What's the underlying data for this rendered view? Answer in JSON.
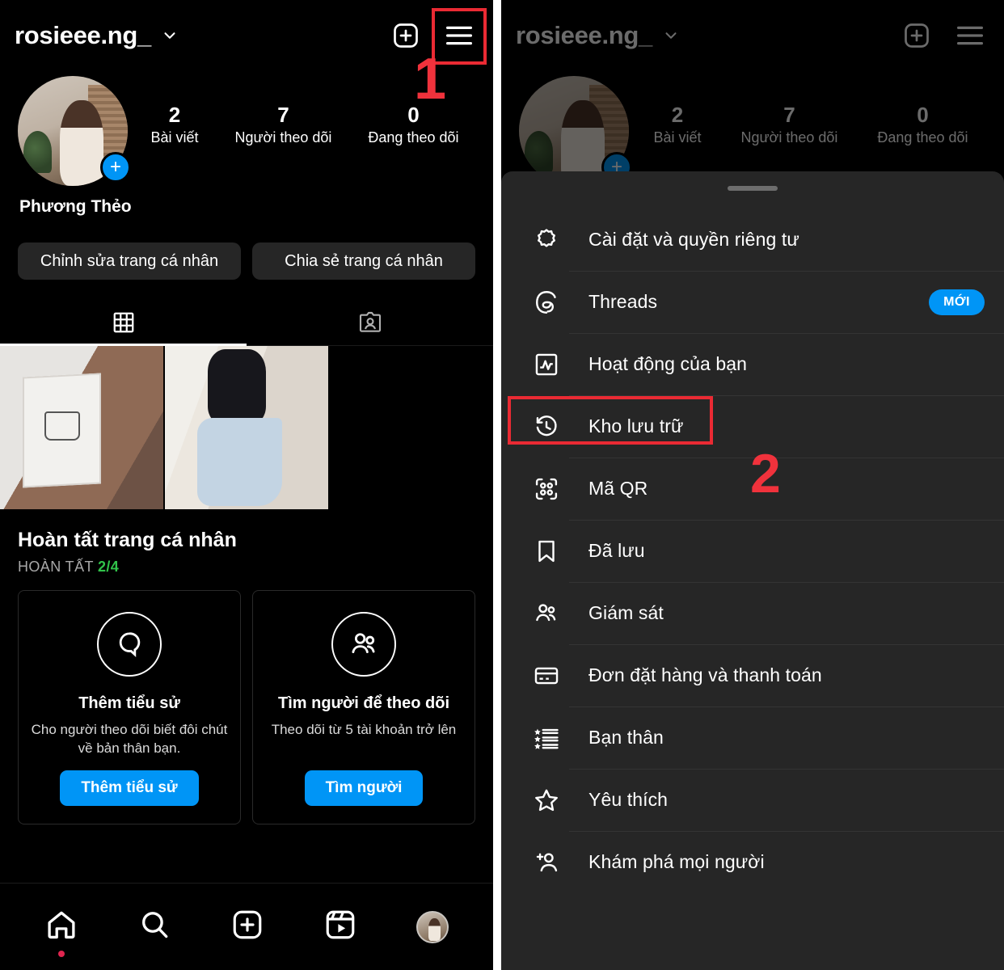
{
  "profile": {
    "username": "rosieee.ng_",
    "display_name": "Phương Thẻo",
    "stats": [
      {
        "value": "2",
        "label": "Bài viết"
      },
      {
        "value": "7",
        "label": "Người theo dõi"
      },
      {
        "value": "0",
        "label": "Đang theo dõi"
      }
    ],
    "buttons": {
      "edit_profile": "Chỉnh sửa trang cá nhân",
      "share_profile": "Chia sẻ trang cá nhân"
    },
    "tabs": [
      {
        "name": "grid-tab",
        "icon": "grid-icon",
        "active": true
      },
      {
        "name": "tagged-tab",
        "icon": "tagged-person-icon",
        "active": false
      }
    ]
  },
  "complete_profile": {
    "title": "Hoàn tất trang cá nhân",
    "progress_label": "HOÀN TẤT",
    "progress_value": "2/4",
    "progress_color": "#31c34b",
    "cards": [
      {
        "icon": "bio-bubble-icon",
        "title": "Thêm tiểu sử",
        "desc": "Cho người theo dõi biết đôi chút về bản thân bạn.",
        "cta": "Thêm tiểu sử"
      },
      {
        "icon": "people-icon",
        "title": "Tìm người để theo dõi",
        "desc": "Theo dõi từ 5 tài khoản trở lên",
        "cta": "Tìm người"
      }
    ]
  },
  "bottom_nav": [
    {
      "name": "home",
      "icon": "home-icon",
      "has_dot": true
    },
    {
      "name": "search",
      "icon": "search-icon",
      "has_dot": false
    },
    {
      "name": "create",
      "icon": "plus-square-icon",
      "has_dot": false
    },
    {
      "name": "reels",
      "icon": "reels-icon",
      "has_dot": false
    },
    {
      "name": "profile",
      "icon": "avatar-icon",
      "has_dot": false
    }
  ],
  "menu_sheet": {
    "items": [
      {
        "icon": "gear-icon",
        "label": "Cài đặt và quyền riêng tư",
        "badge": ""
      },
      {
        "icon": "threads-icon",
        "label": "Threads",
        "badge": "MỚI"
      },
      {
        "icon": "activity-icon",
        "label": "Hoạt động của bạn",
        "badge": ""
      },
      {
        "icon": "archive-clock-icon",
        "label": "Kho lưu trữ",
        "badge": ""
      },
      {
        "icon": "qr-code-icon",
        "label": "Mã QR",
        "badge": ""
      },
      {
        "icon": "bookmark-icon",
        "label": "Đã lưu",
        "badge": ""
      },
      {
        "icon": "supervision-icon",
        "label": "Giám sát",
        "badge": ""
      },
      {
        "icon": "credit-card-icon",
        "label": "Đơn đặt hàng và thanh toán",
        "badge": ""
      },
      {
        "icon": "close-friends-icon",
        "label": "Bạn thân",
        "badge": ""
      },
      {
        "icon": "star-icon",
        "label": "Yêu thích",
        "badge": ""
      },
      {
        "icon": "discover-people-icon",
        "label": "Khám phá mọi người",
        "badge": ""
      }
    ],
    "badge_color": "#0095f6"
  },
  "annotations": {
    "step1": "1",
    "step2": "2",
    "color": "#ea2a33"
  }
}
